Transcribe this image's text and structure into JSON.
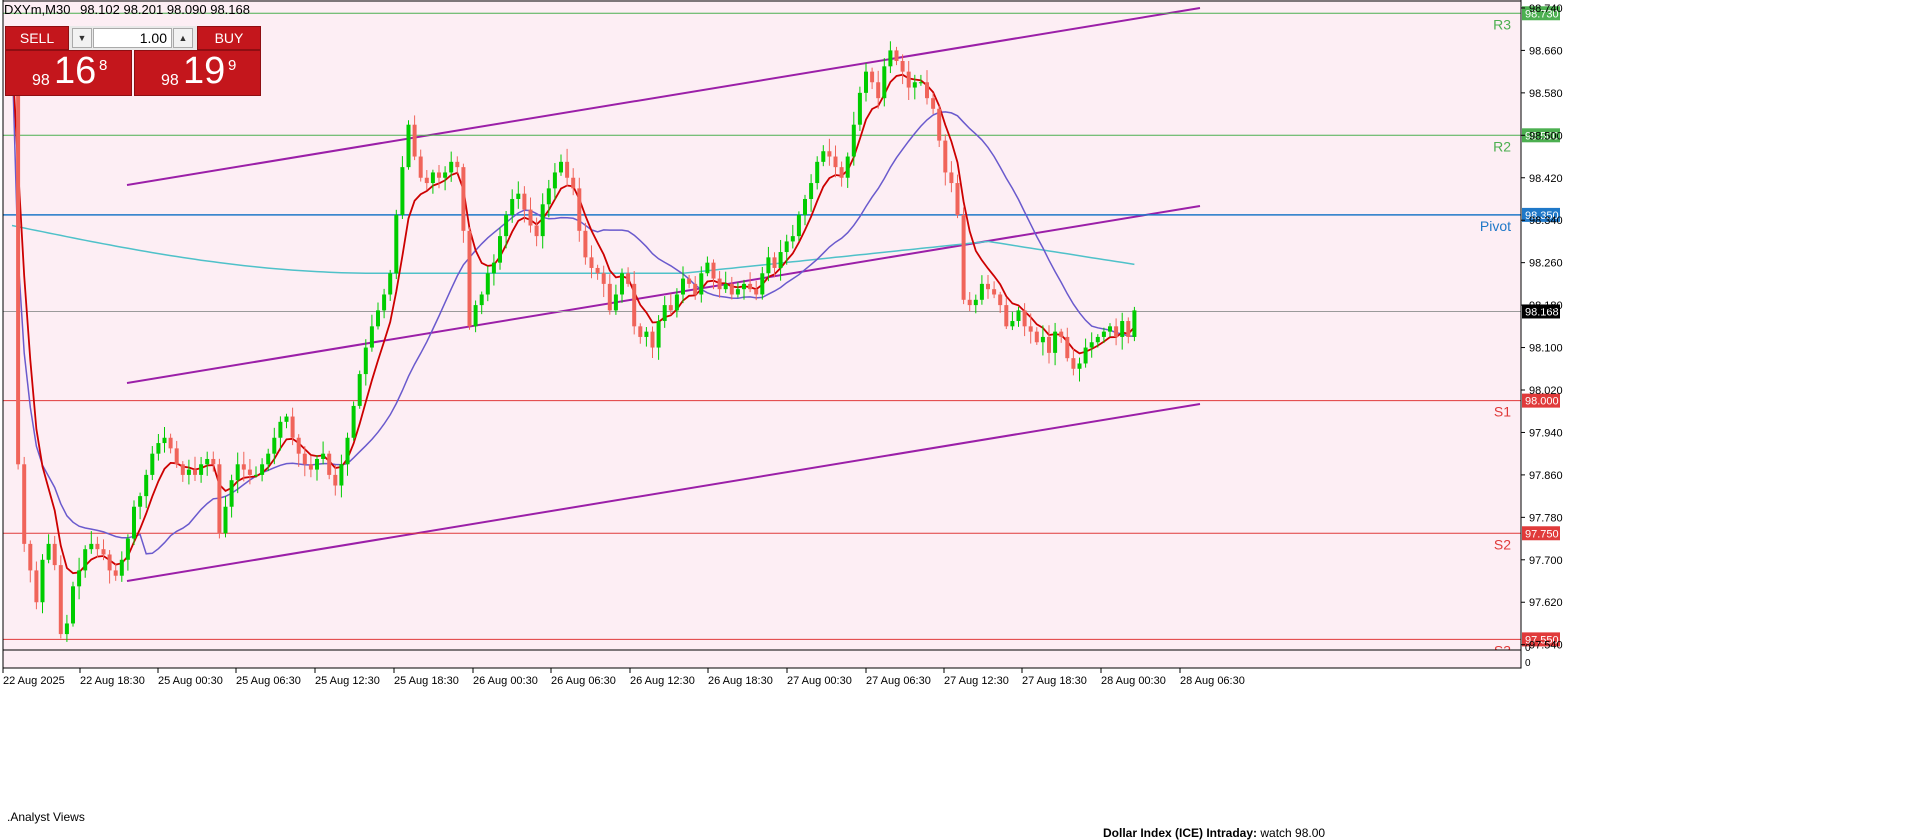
{
  "header": {
    "symbol": "DXYm,M30",
    "ohlc": "98.102 98.201 98.090 98.168"
  },
  "trade_panel": {
    "sell_label": "SELL",
    "buy_label": "BUY",
    "lot_value": "1.00",
    "sell_price": {
      "small": "98",
      "big": "16",
      "sup": "8"
    },
    "buy_price": {
      "small": "98",
      "big": "19",
      "sup": "9"
    }
  },
  "footer": {
    "analyst": ".Analyst Views",
    "comment_bold": "Dollar Index (ICE) Intraday:",
    "comment": "watch 98.00"
  },
  "colors": {
    "background": "#fdeef4",
    "bull": "#00cc00",
    "bear": "#f0645a",
    "ma_fast": "#cc0000",
    "ma_mid": "#6a5acd",
    "ma_slow": "#4fc1c9",
    "channel": "#9b1fa8",
    "resistance": "#4caf50",
    "support": "#e03a3a",
    "pivot": "#1f78c8",
    "current_price_tag": "#000000"
  },
  "chart_data": {
    "type": "line",
    "title": "DXYm,M30",
    "x_labels": [
      "22 Aug 2025",
      "22 Aug 18:30",
      "25 Aug 00:30",
      "25 Aug 06:30",
      "25 Aug 12:30",
      "25 Aug 18:30",
      "26 Aug 00:30",
      "26 Aug 06:30",
      "26 Aug 12:30",
      "26 Aug 18:30",
      "27 Aug 00:30",
      "27 Aug 06:30",
      "27 Aug 12:30",
      "27 Aug 18:30",
      "28 Aug 00:30",
      "28 Aug 06:30"
    ],
    "y_ticks": [
      "98.740",
      "98.660",
      "98.580",
      "98.500",
      "98.420",
      "98.340",
      "98.260",
      "98.180",
      "98.100",
      "98.020",
      "97.940",
      "97.860",
      "97.780",
      "97.700",
      "97.620",
      "97.540"
    ],
    "ylim": [
      97.53,
      98.755
    ],
    "current_price": "98.168",
    "levels": [
      {
        "name": "R3",
        "value": 98.73,
        "label": "98.730",
        "kind": "resistance"
      },
      {
        "name": "R2",
        "value": 98.5,
        "label": "98.500",
        "kind": "resistance"
      },
      {
        "name": "Pivot",
        "value": 98.35,
        "label": "98.350",
        "kind": "pivot"
      },
      {
        "name": "S1",
        "value": 98.0,
        "label": "98.000",
        "kind": "support"
      },
      {
        "name": "S2",
        "value": 97.75,
        "label": "97.750",
        "kind": "support"
      },
      {
        "name": "S3",
        "value": 97.55,
        "label": "97.550",
        "kind": "support"
      }
    ],
    "indicator_scale": {
      "top": "0",
      "bottom": "0"
    },
    "candles_close": [
      98.66,
      97.88,
      97.73,
      97.68,
      97.62,
      97.7,
      97.73,
      97.69,
      97.56,
      97.58,
      97.65,
      97.68,
      97.72,
      97.73,
      97.72,
      97.71,
      97.68,
      97.67,
      97.7,
      97.74,
      97.8,
      97.82,
      97.86,
      97.9,
      97.92,
      97.93,
      97.91,
      97.88,
      97.86,
      97.87,
      97.86,
      97.88,
      97.89,
      97.88,
      97.75,
      97.8,
      97.85,
      97.88,
      97.87,
      97.86,
      97.86,
      97.88,
      97.9,
      97.93,
      97.96,
      97.97,
      97.93,
      97.9,
      97.88,
      97.87,
      97.89,
      97.9,
      97.86,
      97.84,
      97.88,
      97.93,
      97.99,
      98.05,
      98.1,
      98.14,
      98.17,
      98.2,
      98.24,
      98.35,
      98.44,
      98.52,
      98.46,
      98.42,
      98.41,
      98.43,
      98.42,
      98.43,
      98.45,
      98.44,
      98.32,
      98.14,
      98.18,
      98.2,
      98.24,
      98.26,
      98.31,
      98.35,
      98.38,
      98.39,
      98.36,
      98.33,
      98.31,
      98.37,
      98.4,
      98.43,
      98.45,
      98.42,
      98.4,
      98.32,
      98.27,
      98.25,
      98.24,
      98.22,
      98.17,
      98.2,
      98.24,
      98.22,
      98.14,
      98.12,
      98.13,
      98.1,
      98.15,
      98.18,
      98.17,
      98.2,
      98.23,
      98.22,
      98.2,
      98.24,
      98.26,
      98.23,
      98.21,
      98.22,
      98.2,
      98.21,
      98.22,
      98.21,
      98.2,
      98.24,
      98.27,
      98.25,
      98.28,
      98.3,
      98.31,
      98.35,
      98.38,
      98.41,
      98.45,
      98.47,
      98.46,
      98.44,
      98.42,
      98.46,
      98.52,
      98.58,
      98.62,
      98.6,
      98.57,
      98.63,
      98.66,
      98.64,
      98.62,
      98.59,
      98.6,
      98.6,
      98.57,
      98.55,
      98.49,
      98.43,
      98.41,
      98.35,
      98.19,
      98.18,
      98.19,
      98.22,
      98.21,
      98.2,
      98.18,
      98.14,
      98.15,
      98.17,
      98.14,
      98.13,
      98.11,
      98.12,
      98.09,
      98.13,
      98.12,
      98.08,
      98.06,
      98.07,
      98.1,
      98.11,
      98.12,
      98.13,
      98.14,
      98.12,
      98.15,
      98.12,
      98.17
    ]
  }
}
